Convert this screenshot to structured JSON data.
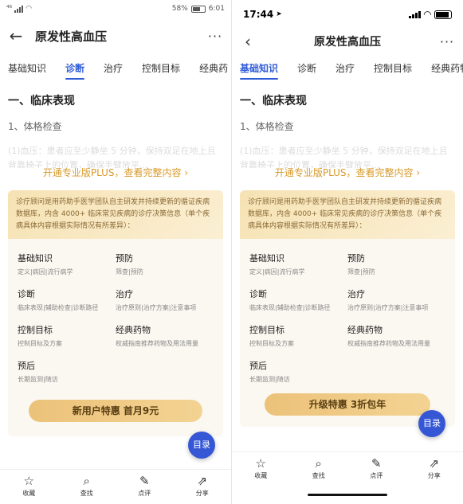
{
  "left": {
    "status": {
      "left_text": "⁴⁶",
      "battery": "58%",
      "time": "6:01"
    },
    "nav": {
      "title": "原发性高血压",
      "more": "···",
      "back": "←"
    },
    "tabs": [
      "基础知识",
      "诊断",
      "治疗",
      "控制目标",
      "经典药"
    ],
    "active_tab": 1,
    "section_title": "一、临床表现",
    "subsection": "1、体格检查",
    "faded_text": "(1)血压：患者应至少静坐 5 分钟，保持双足在地上且背靠椅子上的位置，确保手臂放平...",
    "unlock_text": "开通专业版PLUS，查看完整内容 ›",
    "card_intro": "诊疗顾问是用药助手医学团队自主研发并持续更新的循证疾病数据库，内含 4000+ 临床常见疾病的诊疗决策信息（单个疾病具体内容根据实际情况有所差异）：",
    "grid": [
      {
        "title": "基础知识",
        "sub": "定义|病因|流行病学"
      },
      {
        "title": "预防",
        "sub": "筛查|预防"
      },
      {
        "title": "诊断",
        "sub": "临床表现|辅助检查|诊断路径"
      },
      {
        "title": "治疗",
        "sub": "治疗原则|治疗方案|注意事项"
      },
      {
        "title": "控制目标",
        "sub": "控制目标及方案"
      },
      {
        "title": "经典药物",
        "sub": "权威指南推荐药物及用法用量"
      },
      {
        "title": "预后",
        "sub": "长期监测|随访"
      }
    ],
    "cta": "新用户特惠 首月9元",
    "fab": "目录",
    "bottom": [
      {
        "icon": "☆",
        "label": "收藏"
      },
      {
        "icon": "⌕",
        "label": "查找"
      },
      {
        "icon": "✎",
        "label": "点评"
      },
      {
        "icon": "⇗",
        "label": "分享"
      }
    ]
  },
  "right": {
    "status": {
      "time": "17:44"
    },
    "nav": {
      "title": "原发性高血压",
      "more": "···",
      "back": "‹"
    },
    "tabs": [
      "基础知识",
      "诊断",
      "治疗",
      "控制目标",
      "经典药物"
    ],
    "active_tab": 0,
    "section_title": "一、临床表现",
    "subsection": "1、体格检查",
    "faded_text": "(1)血压：患者应至少静坐 5 分钟，保持双足在地上且背靠椅子上的位置，确保手臂放平...",
    "unlock_text": "开通专业版PLUS，查看完整内容 ›",
    "card_intro": "诊疗顾问是用药助手医学团队自主研发并持续更新的循证疾病数据库，内含 4000+ 临床常见疾病的诊疗决策信息（单个疾病具体内容根据实际情况有所差异）：",
    "grid": [
      {
        "title": "基础知识",
        "sub": "定义|病因|流行病学"
      },
      {
        "title": "预防",
        "sub": "筛查|预防"
      },
      {
        "title": "诊断",
        "sub": "临床表现|辅助检查|诊断路径"
      },
      {
        "title": "治疗",
        "sub": "治疗原则|治疗方案|注意事项"
      },
      {
        "title": "控制目标",
        "sub": "控制目标及方案"
      },
      {
        "title": "经典药物",
        "sub": "权威指南推荐药物及用法用量"
      },
      {
        "title": "预后",
        "sub": "长期监测|随访"
      }
    ],
    "cta": "升级特惠 3折包年",
    "fab": "目录",
    "bottom": [
      {
        "icon": "☆",
        "label": "收藏"
      },
      {
        "icon": "⌕",
        "label": "查找"
      },
      {
        "icon": "✎",
        "label": "点评"
      },
      {
        "icon": "⇗",
        "label": "分享"
      }
    ]
  },
  "colors": {
    "accent": "#2f5bd8",
    "gold": "#d89a2a",
    "fab": "#3557d6"
  }
}
